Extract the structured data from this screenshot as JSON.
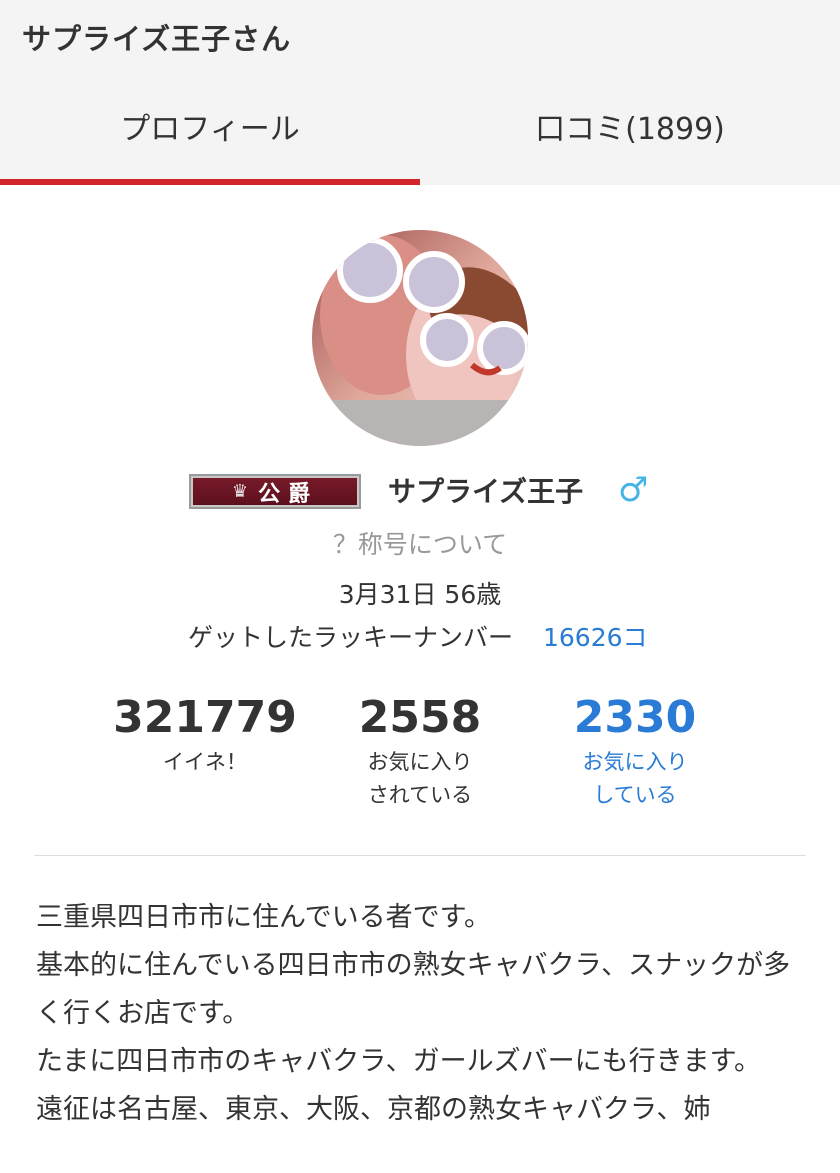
{
  "header": {
    "title": "サプライズ王子さん",
    "tabs": [
      {
        "label": "プロフィール",
        "active": true
      },
      {
        "label": "口コミ(1899)",
        "active": false
      }
    ],
    "accent_color": "#d0262b"
  },
  "profile": {
    "avatar_icon": "profile-photo",
    "rank_badge": {
      "label": "公爵",
      "icon": "crown-icon"
    },
    "username": "サプライズ王子",
    "gender_icon": "♂",
    "title_help": "？称号について",
    "birthday": "3月31日 56歳",
    "lucky_label": "ゲットしたラッキーナンバー",
    "lucky_value": "16626コ"
  },
  "stats": [
    {
      "value": "321779",
      "label_lines": [
        "イイネ！"
      ]
    },
    {
      "value": "2558",
      "label_lines": [
        "お気に入り",
        "されている"
      ]
    },
    {
      "value": "2330",
      "label_lines": [
        "お気に入り",
        "している"
      ],
      "link_color": "#2a7bd6"
    }
  ],
  "bio": [
    "三重県四日市市に住んでいる者です。",
    "基本的に住んでいる四日市市の熟女キャバクラ、スナックが多く行くお店です。",
    "たまに四日市市のキャバクラ、ガールズバーにも行きます。",
    "遠征は名古屋、東京、大阪、京都の熟女キャバクラ、姉"
  ]
}
